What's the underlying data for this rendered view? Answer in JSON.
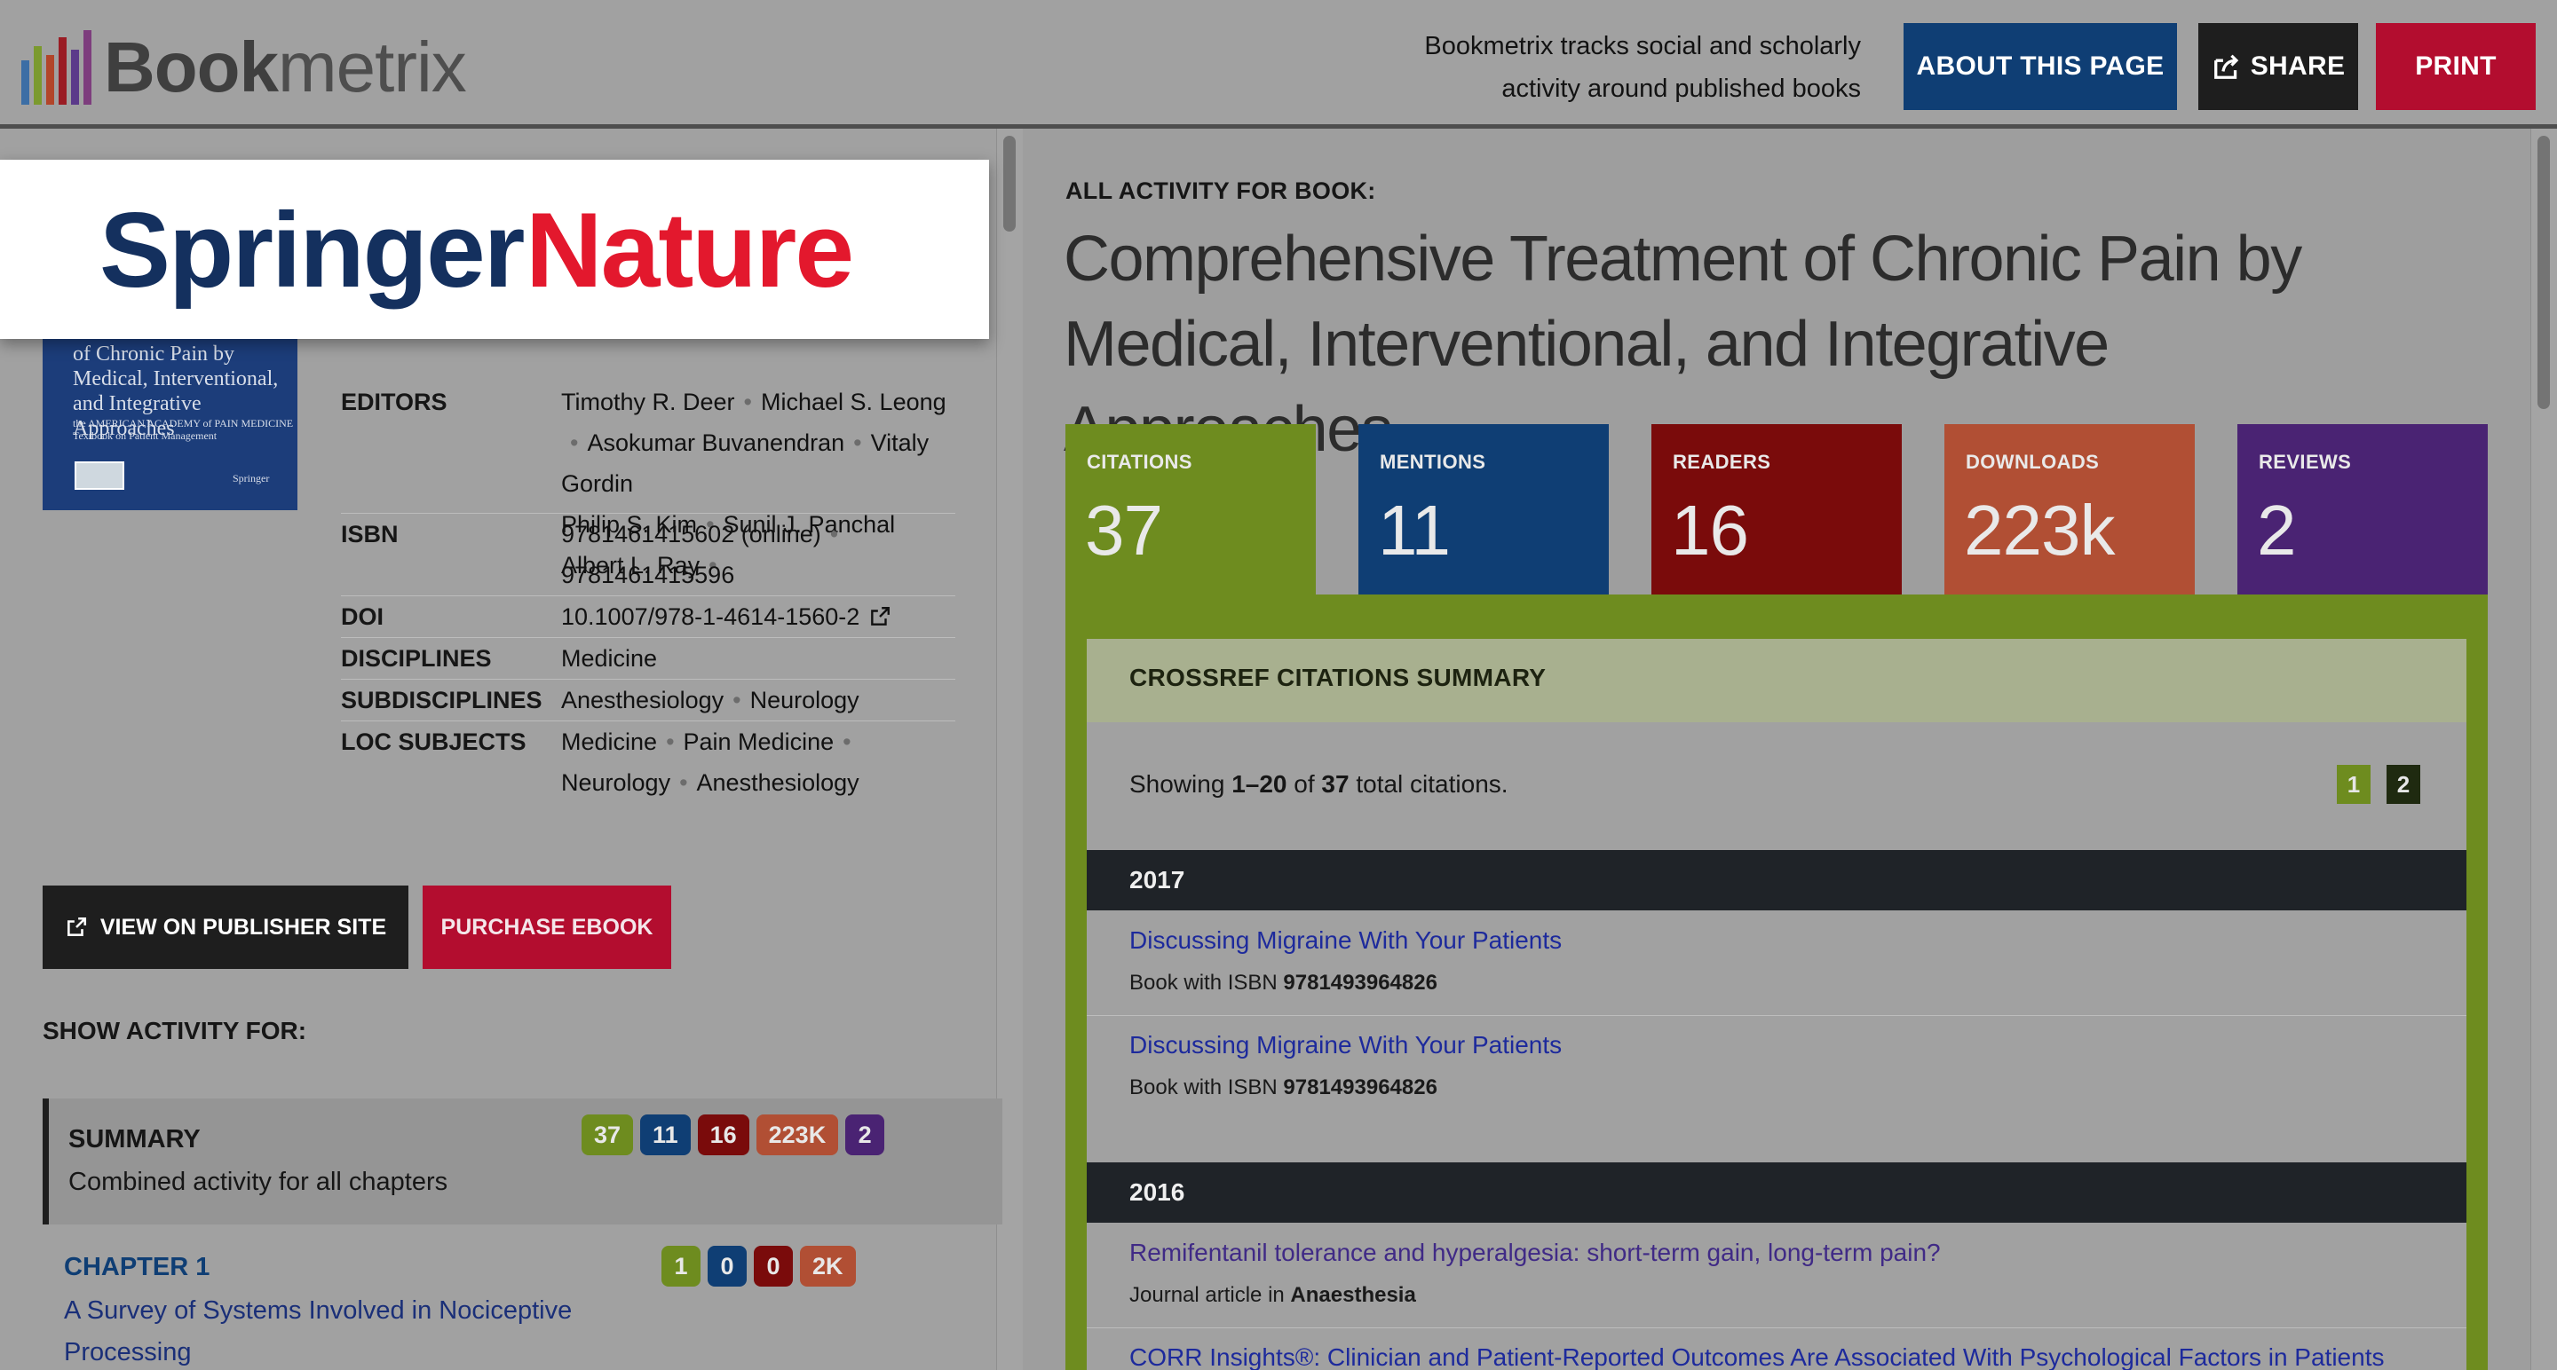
{
  "header": {
    "logo_bold": "Book",
    "logo_light": "metrix",
    "tagline_line1": "Bookmetrix tracks social and scholarly",
    "tagline_line2": "activity around published books",
    "about_label": "ABOUT THIS PAGE",
    "share_label": "SHARE",
    "print_label": "PRINT"
  },
  "overlay": {
    "springer_word1": "Springer",
    "springer_word2": "Nature"
  },
  "cover": {
    "title": "of Chronic Pain by Medical, Interventional, and Integrative Approaches",
    "subtitle": "the AMERICAN ACADEMY of PAIN MEDICINE Textbook on Patient Management",
    "publisher": "Springer"
  },
  "meta": {
    "editors_label": "EDITORS",
    "editors": [
      "Timothy R. Deer",
      "Michael S. Leong",
      "Asokumar Buvanendran",
      "Vitaly Gordin",
      "Philip S. Kim",
      "Sunil J. Panchal",
      "Albert L. Ray"
    ],
    "isbn_label": "ISBN",
    "isbn_online": "9781461415602 (online)",
    "isbn_print": "9781461415596",
    "doi_label": "DOI",
    "doi": "10.1007/978-1-4614-1560-2",
    "disciplines_label": "DISCIPLINES",
    "disciplines": "Medicine",
    "subdisciplines_label": "SUBDISCIPLINES",
    "subdisciplines": [
      "Anesthesiology",
      "Neurology"
    ],
    "loc_label": "LOC SUBJECTS",
    "loc_subjects": [
      "Medicine",
      "Pain Medicine",
      "Neurology",
      "Anesthesiology"
    ]
  },
  "actions": {
    "publisher_label": "VIEW ON PUBLISHER SITE",
    "purchase_label": "PURCHASE EBOOK"
  },
  "activity": {
    "heading": "SHOW ACTIVITY FOR:",
    "summary": {
      "title": "SUMMARY",
      "desc": "Combined activity for all chapters",
      "chips": [
        "37",
        "11",
        "16",
        "223K",
        "2"
      ]
    },
    "chapter1": {
      "title": "CHAPTER 1",
      "desc": "A Survey of Systems Involved in Nociceptive Processing",
      "chips": [
        "1",
        "0",
        "0",
        "2K"
      ]
    }
  },
  "main": {
    "eyebrow": "ALL ACTIVITY FOR BOOK:",
    "title": "Comprehensive Treatment of Chronic Pain by Medical, Interventional, and Integrative Approaches",
    "stats": [
      {
        "label": "CITATIONS",
        "value": "37",
        "color": "#6e8c1f"
      },
      {
        "label": "MENTIONS",
        "value": "11",
        "color": "#0f3e74"
      },
      {
        "label": "READERS",
        "value": "16",
        "color": "#7a0b0b"
      },
      {
        "label": "DOWNLOADS",
        "value": "223k",
        "color": "#b14f34"
      },
      {
        "label": "REVIEWS",
        "value": "2",
        "color": "#4a2373"
      }
    ]
  },
  "citations": {
    "heading": "CROSSREF CITATIONS SUMMARY",
    "showing_prefix": "Showing ",
    "showing_range": "1–20",
    "showing_of": " of ",
    "showing_total": "37",
    "showing_suffix": " total citations.",
    "pages": [
      "1",
      "2"
    ],
    "year_2017": "2017",
    "year_2016": "2016",
    "items": [
      {
        "title": "Discussing Migraine With Your Patients",
        "kind": "Book with ISBN ",
        "source": "9781493964826"
      },
      {
        "title": "Discussing Migraine With Your Patients",
        "kind": "Book with ISBN ",
        "source": "9781493964826"
      },
      {
        "title": "Remifentanil tolerance and hyperalgesia: short-term gain, long-term pain?",
        "kind": "Journal article in ",
        "source": "Anaesthesia"
      },
      {
        "title": "CORR Insights®: Clinician and Patient-Reported Outcomes Are Associated With Psychological Factors in Patients",
        "kind": "",
        "source": ""
      }
    ]
  },
  "colors": {
    "citations": "#6e8c1f",
    "mentions": "#0f3e74",
    "readers": "#7a0b0b",
    "downloads": "#b14f34",
    "reviews": "#4a2373"
  }
}
